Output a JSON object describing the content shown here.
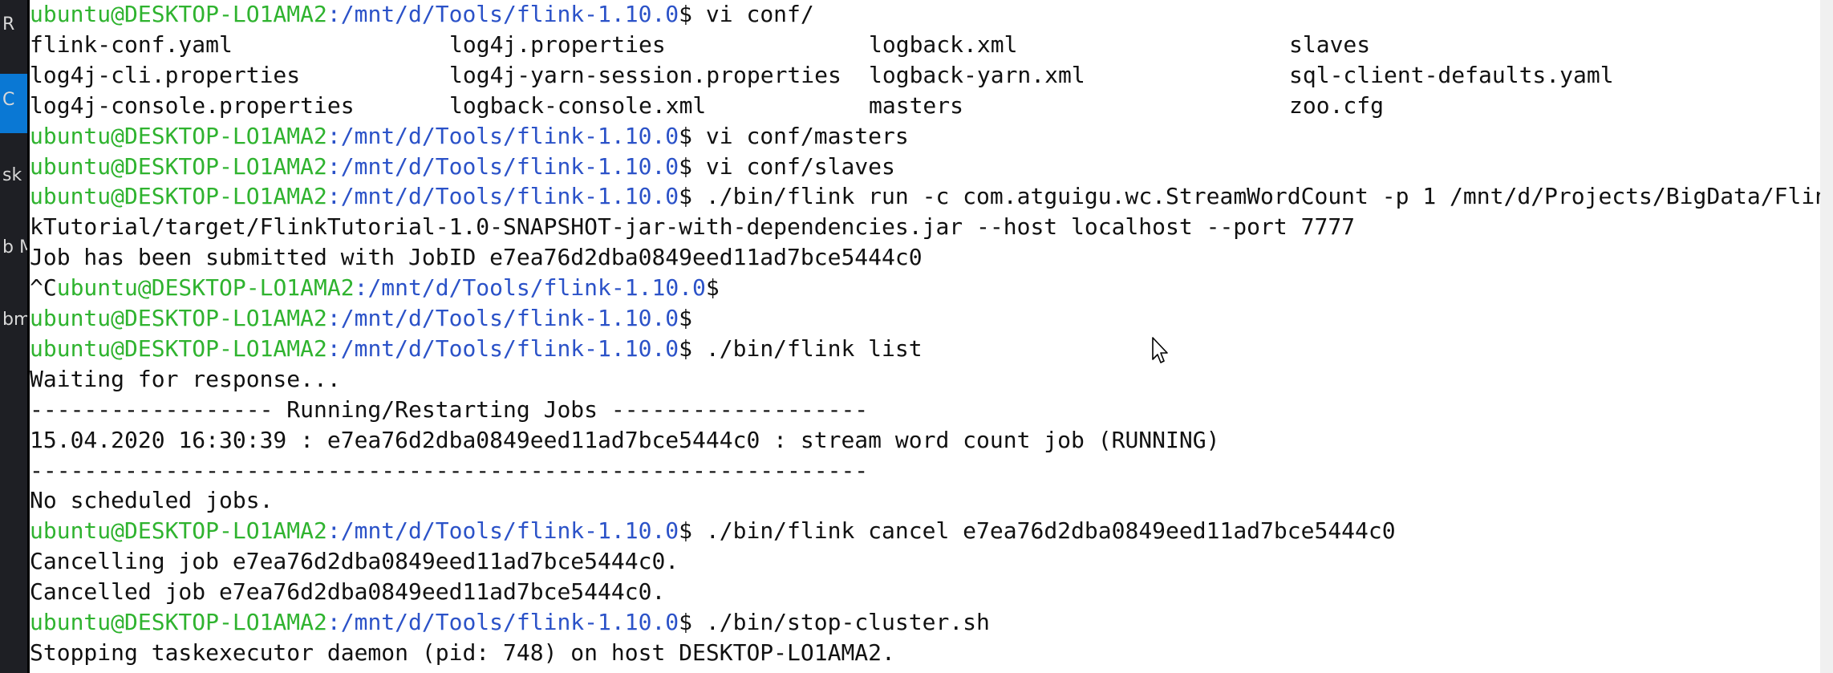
{
  "sidebar": {
    "items": [
      {
        "label": "R"
      },
      {
        "label": "C"
      },
      {
        "label": "sk M"
      },
      {
        "label": "b M"
      },
      {
        "label": "bm"
      }
    ]
  },
  "terminal": {
    "prompt_user": "ubuntu@DESKTOP-LO1AMA2",
    "prompt_path": ":/mnt/d/Tools/flink-1.10.0",
    "prompt_end": "$",
    "lines": [
      {
        "type": "prompt",
        "cmd": " vi conf/"
      },
      {
        "type": "grid",
        "cols": [
          "flink-conf.yaml",
          "log4j.properties",
          "logback.xml",
          "slaves"
        ]
      },
      {
        "type": "grid",
        "cols": [
          "log4j-cli.properties",
          "log4j-yarn-session.properties",
          "logback-yarn.xml",
          "sql-client-defaults.yaml"
        ]
      },
      {
        "type": "grid",
        "cols": [
          "log4j-console.properties",
          "logback-console.xml",
          "masters",
          "zoo.cfg"
        ]
      },
      {
        "type": "prompt",
        "cmd": " vi conf/masters"
      },
      {
        "type": "prompt",
        "cmd": " vi conf/slaves"
      },
      {
        "type": "prompt",
        "cmd": " ./bin/flink run -c com.atguigu.wc.StreamWordCount -p 1 /mnt/d/Projects/BigData/Flin"
      },
      {
        "type": "text",
        "text": "kTutorial/target/FlinkTutorial-1.0-SNAPSHOT-jar-with-dependencies.jar --host localhost --port 7777"
      },
      {
        "type": "text",
        "text": "Job has been submitted with JobID e7ea76d2dba0849eed11ad7bce5444c0"
      },
      {
        "type": "prompt",
        "prefix": "^C",
        "cmd": ""
      },
      {
        "type": "prompt",
        "cmd": ""
      },
      {
        "type": "prompt",
        "cmd": " ./bin/flink list"
      },
      {
        "type": "text",
        "text": "Waiting for response..."
      },
      {
        "type": "text",
        "text": "------------------ Running/Restarting Jobs -------------------"
      },
      {
        "type": "text",
        "text": "15.04.2020 16:30:39 : e7ea76d2dba0849eed11ad7bce5444c0 : stream word count job (RUNNING)"
      },
      {
        "type": "text",
        "text": "--------------------------------------------------------------"
      },
      {
        "type": "text",
        "text": "No scheduled jobs."
      },
      {
        "type": "prompt",
        "cmd": " ./bin/flink cancel e7ea76d2dba0849eed11ad7bce5444c0"
      },
      {
        "type": "text",
        "text": "Cancelling job e7ea76d2dba0849eed11ad7bce5444c0."
      },
      {
        "type": "text",
        "text": "Cancelled job e7ea76d2dba0849eed11ad7bce5444c0."
      },
      {
        "type": "prompt",
        "cmd": " ./bin/stop-cluster.sh"
      },
      {
        "type": "text",
        "text": "Stopping taskexecutor daemon (pid: 748) on host DESKTOP-LO1AMA2."
      }
    ]
  },
  "colors": {
    "background": "#ffffff",
    "text": "#111111",
    "prompt_user": "#2fb32f",
    "prompt_path": "#2b52c8",
    "sidebar_bg": "#1e1f24",
    "sidebar_accent": "#0a78d4"
  },
  "icons": {
    "cursor": "mouse-pointer-icon"
  }
}
